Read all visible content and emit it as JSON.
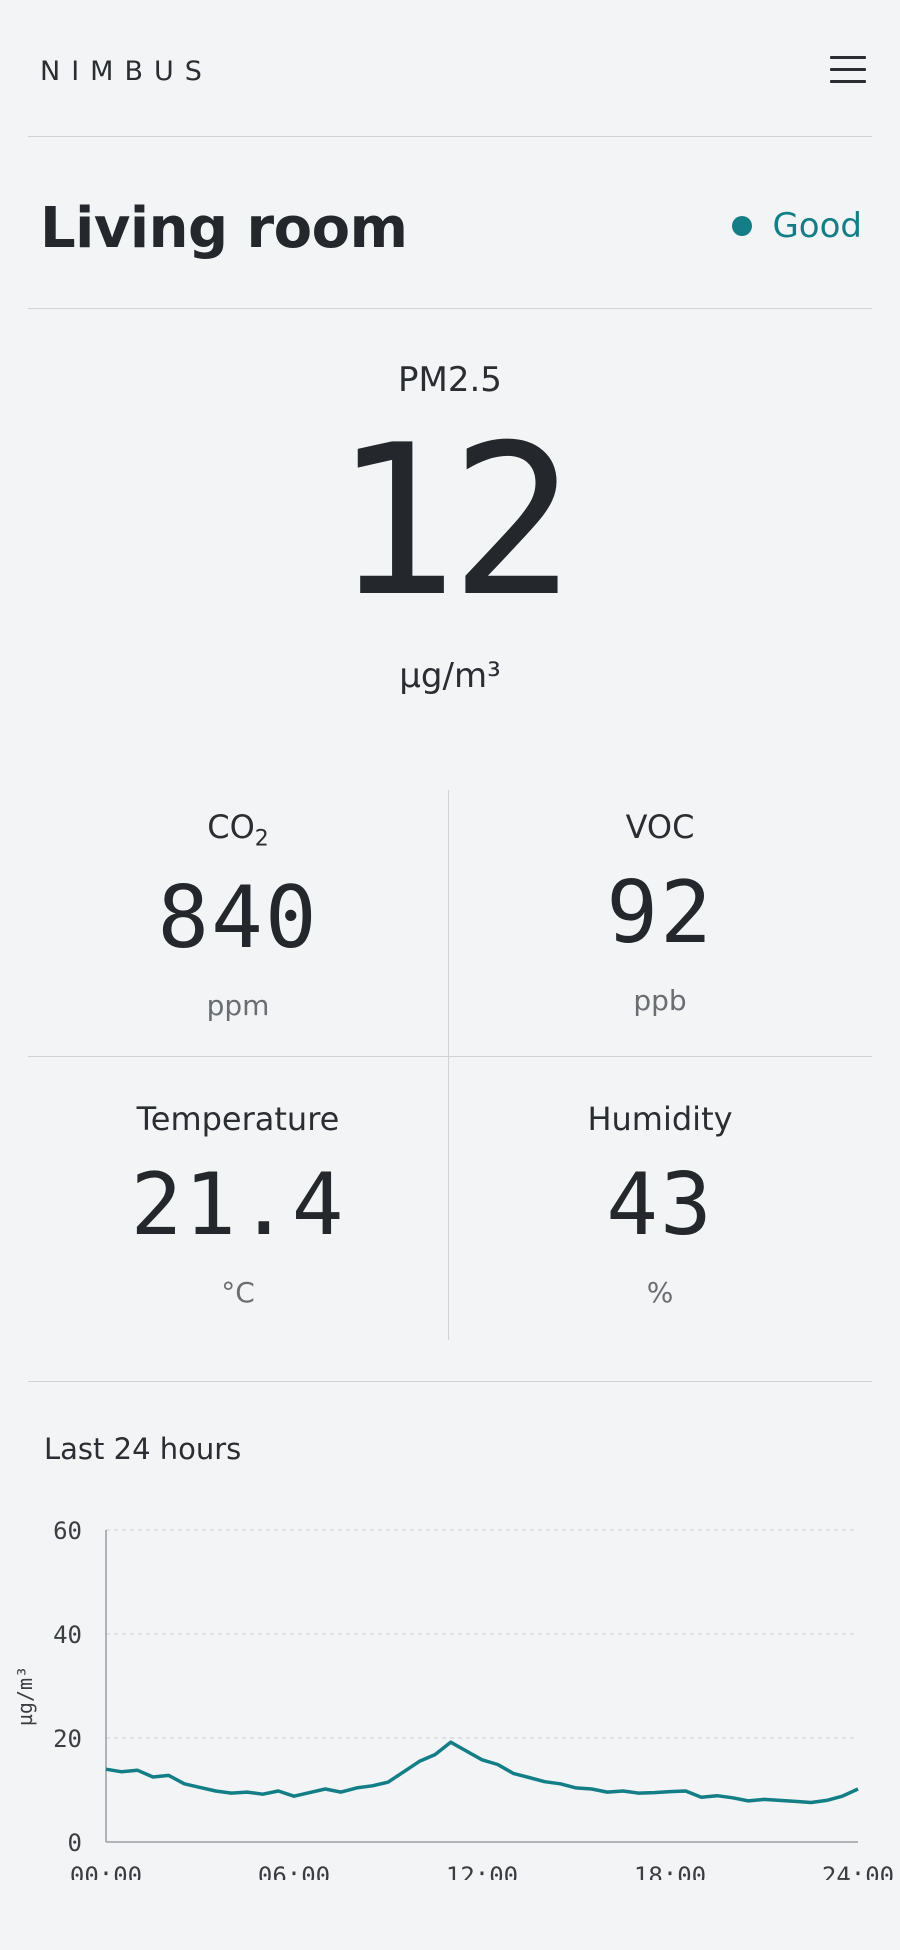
{
  "header": {
    "brand": "NIMBUS",
    "menu_icon": "hamburger-menu-icon"
  },
  "room": {
    "name": "Living room",
    "status": "Good",
    "status_color": "#137e86"
  },
  "primary": {
    "label": "PM2.5",
    "value": "12",
    "unit": "µg/m³"
  },
  "metrics": [
    {
      "label_main": "CO",
      "label_sub": "2",
      "value": "840",
      "unit": "ppm"
    },
    {
      "label_main": "VOC",
      "label_sub": "",
      "value": "92",
      "unit": "ppb"
    },
    {
      "label_main": "Temperature",
      "label_sub": "",
      "value": "21.4",
      "unit": "°C"
    },
    {
      "label_main": "Humidity",
      "label_sub": "",
      "value": "43",
      "unit": "%"
    }
  ],
  "chart_section": {
    "title": "Last 24 hours"
  },
  "chart_data": {
    "type": "line",
    "ylabel": "µg/m³",
    "xlabel": "",
    "ylim": [
      0,
      60
    ],
    "xlim": [
      0,
      24
    ],
    "y_ticks": [
      "0",
      "20",
      "40",
      "60"
    ],
    "y_tick_values": [
      0,
      20,
      40,
      60
    ],
    "x_ticks": [
      "00:00",
      "06:00",
      "12:00",
      "18:00",
      "24:00"
    ],
    "x_tick_values": [
      0,
      6,
      12,
      18,
      24
    ],
    "grid": "horizontal dashed",
    "line_color": "#137e86",
    "series": [
      {
        "x": [
          0,
          0.5,
          1,
          1.5,
          2,
          2.5,
          3,
          3.5,
          4,
          4.5,
          5,
          5.5,
          6,
          6.5,
          7,
          7.5,
          8,
          8.5,
          9,
          9.5,
          10,
          10.5,
          11,
          11.5,
          12,
          12.5,
          13,
          13.5,
          14,
          14.5,
          15,
          15.5,
          16,
          16.5,
          17,
          17.5,
          18,
          18.5,
          19,
          19.5,
          20,
          20.5,
          21,
          21.5,
          22,
          22.5,
          23,
          23.5,
          24
        ],
        "values": [
          14,
          13.5,
          13.8,
          12.5,
          12.8,
          11.2,
          10.5,
          9.8,
          9.4,
          9.6,
          9.2,
          9.8,
          8.8,
          9.5,
          10.2,
          9.6,
          10.4,
          10.8,
          11.5,
          13.5,
          15.5,
          16.8,
          19.2,
          17.5,
          15.8,
          14.9,
          13.2,
          12.4,
          11.6,
          11.2,
          10.4,
          10.2,
          9.6,
          9.8,
          9.4,
          9.5,
          9.7,
          9.8,
          8.6,
          8.9,
          8.5,
          7.9,
          8.2,
          8.0,
          7.8,
          7.6,
          8.0,
          8.8,
          10.2
        ]
      }
    ]
  }
}
